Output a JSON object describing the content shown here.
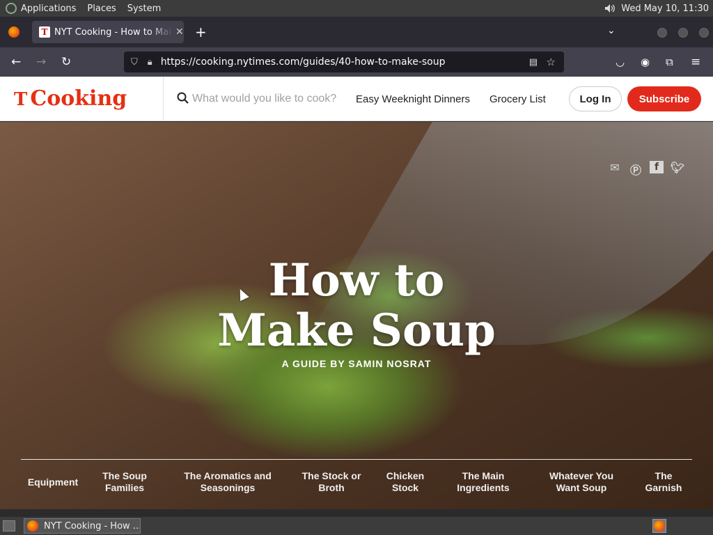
{
  "os_panel": {
    "menus": [
      "Applications",
      "Places",
      "System"
    ],
    "clock": "Wed May 10, 11:30"
  },
  "browser": {
    "tab_title": "NYT Cooking - How to Make Soup",
    "tab_favicon": "T",
    "url": "https://cooking.nytimes.com/guides/40-how-to-make-soup"
  },
  "site": {
    "brand": "Cooking",
    "brand_mark": "T",
    "search_placeholder": "What would you like to cook?",
    "nav": [
      "Easy Weeknight Dinners",
      "Grocery List"
    ],
    "login_label": "Log In",
    "subscribe_label": "Subscribe",
    "accent_color": "#e22a1c"
  },
  "hero": {
    "title_line1": "How to",
    "title_line2": "Make Soup",
    "subtitle": "A GUIDE BY SAMIN NOSRAT",
    "share_icons": [
      "email-icon",
      "pinterest-icon",
      "facebook-icon",
      "twitter-icon"
    ],
    "guide_nav": [
      [
        "Equipment"
      ],
      [
        "The Soup",
        "Families"
      ],
      [
        "The Aromatics and",
        "Seasonings"
      ],
      [
        "The Stock or",
        "Broth"
      ],
      [
        "Chicken",
        "Stock"
      ],
      [
        "The Main",
        "Ingredients"
      ],
      [
        "Whatever You",
        "Want Soup"
      ],
      [
        "The",
        "Garnish"
      ]
    ]
  },
  "taskbar": {
    "task_label": "NYT Cooking - How …"
  }
}
